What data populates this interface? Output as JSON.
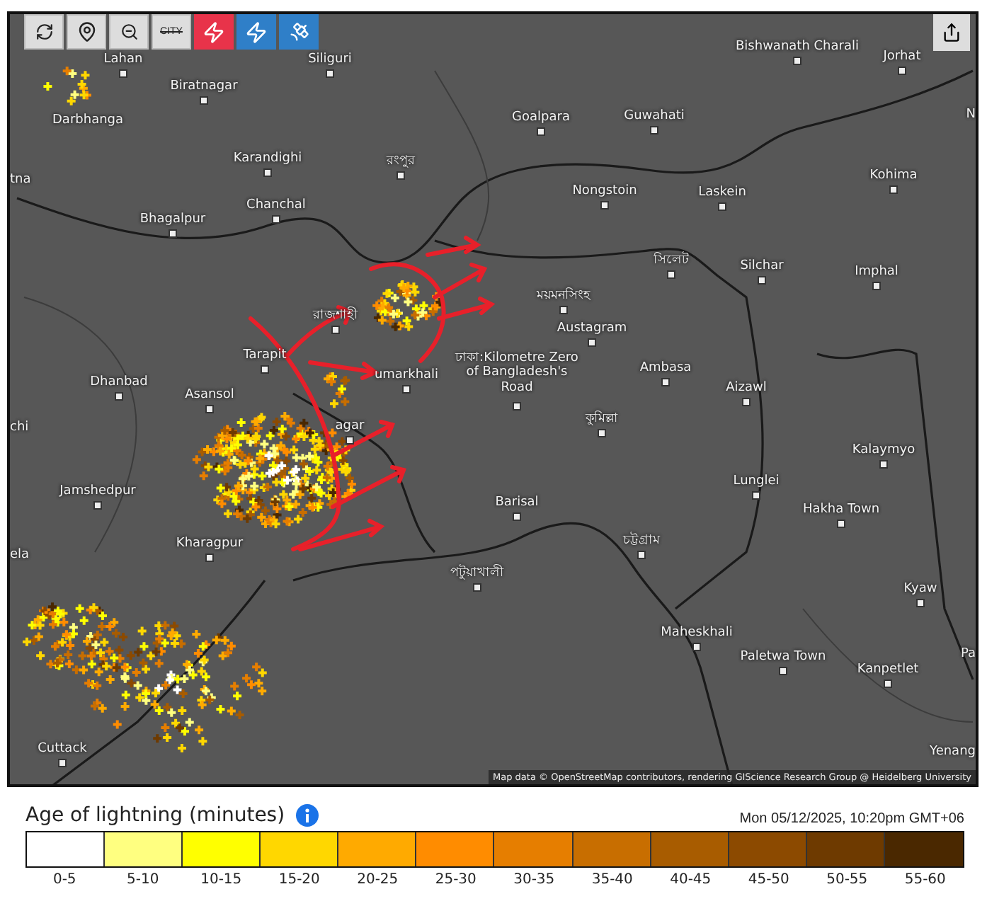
{
  "toolbar": [
    {
      "kind": "refresh",
      "on": false,
      "color": "#dddddd"
    },
    {
      "kind": "pin",
      "on": false,
      "color": "#dddddd"
    },
    {
      "kind": "zoom-out",
      "on": false,
      "color": "#dddddd"
    },
    {
      "kind": "city",
      "label": "CITY",
      "on": false,
      "color": "#dddddd"
    },
    {
      "kind": "lightning",
      "on": true,
      "color": "#e8334a"
    },
    {
      "kind": "ground-strike",
      "on": true,
      "color": "#2f7fc8"
    },
    {
      "kind": "satellite",
      "on": true,
      "color": "#2f7fc8"
    }
  ],
  "map": {
    "labels": [
      {
        "text": "Lahan"
      },
      {
        "text": "Siliguri"
      },
      {
        "text": "Biratnagar"
      },
      {
        "text": "Darbhanga"
      },
      {
        "text": "tna"
      },
      {
        "text": "Karandighi"
      },
      {
        "text": "রংপুর"
      },
      {
        "text": "Chanchal"
      },
      {
        "text": "Bhagalpur"
      },
      {
        "text": "Bishwanath Charali"
      },
      {
        "text": "Jorhat"
      },
      {
        "text": "Goalpara"
      },
      {
        "text": "Guwahati"
      },
      {
        "text": "N"
      },
      {
        "text": "Nongstoin"
      },
      {
        "text": "Laskein"
      },
      {
        "text": "Kohima"
      },
      {
        "text": "সিলেট"
      },
      {
        "text": "Silchar"
      },
      {
        "text": "Imphal"
      },
      {
        "text": "ময়মনসিংহ"
      },
      {
        "text": "Austagram"
      },
      {
        "text": "রাজশাহী"
      },
      {
        "text": "Tarapit"
      },
      {
        "text": "ঢাকা:Kilometre Zero of Bangladesh's Road"
      },
      {
        "text": "Ambasa"
      },
      {
        "text": "Aizawl"
      },
      {
        "text": "Dhanbad"
      },
      {
        "text": "Asansol"
      },
      {
        "text": "umarkhali"
      },
      {
        "text": "chi"
      },
      {
        "text": "কুমিল্লা"
      },
      {
        "text": "Kalaymyo"
      },
      {
        "text": "agar"
      },
      {
        "text": "Jamshedpur"
      },
      {
        "text": "Barisal"
      },
      {
        "text": "Lunglei"
      },
      {
        "text": "Hakha Town"
      },
      {
        "text": "Kharagpur"
      },
      {
        "text": "চট্টগ্রাম"
      },
      {
        "text": "ela"
      },
      {
        "text": "পটুয়াখালী"
      },
      {
        "text": "Kyaw"
      },
      {
        "text": "Maheskhali"
      },
      {
        "text": "Paletwa Town"
      },
      {
        "text": "Kanpetlet"
      },
      {
        "text": "Pa"
      },
      {
        "text": "Cuttack"
      },
      {
        "text": "Yenang"
      }
    ],
    "attribution": "Map data © OpenStreetMap contributors, rendering GIScience Research Group @ Heidelberg University"
  },
  "legend": {
    "title": "Age of lightning (minutes)",
    "timestamp": "Mon 05/12/2025, 10:20pm GMT+06",
    "bins": [
      {
        "label": "0-5",
        "color": "#ffffff"
      },
      {
        "label": "5-10",
        "color": "#ffff80"
      },
      {
        "label": "10-15",
        "color": "#ffff00"
      },
      {
        "label": "15-20",
        "color": "#ffd700"
      },
      {
        "label": "20-25",
        "color": "#ffaa00"
      },
      {
        "label": "25-30",
        "color": "#ff8c00"
      },
      {
        "label": "30-35",
        "color": "#e67e00"
      },
      {
        "label": "35-40",
        "color": "#c86e00"
      },
      {
        "label": "40-45",
        "color": "#a85c00"
      },
      {
        "label": "45-50",
        "color": "#8c4a00"
      },
      {
        "label": "50-55",
        "color": "#6e3a00"
      },
      {
        "label": "55-60",
        "color": "#4a2800"
      }
    ]
  }
}
